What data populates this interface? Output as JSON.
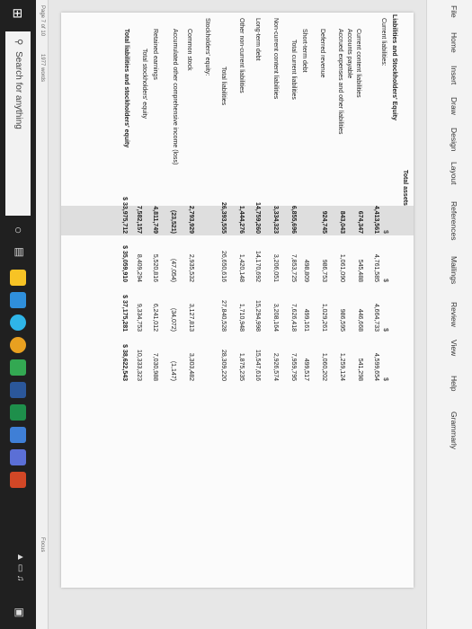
{
  "ribbon": {
    "tabs": [
      "File",
      "Home",
      "Insert",
      "Draw",
      "Design",
      "Layout",
      "References",
      "Mailings",
      "Review",
      "View",
      "Help",
      "Grammarly"
    ]
  },
  "document": {
    "total_assets_label": "Total assets",
    "section_title": "Liabilities and Stockholders' Equity",
    "current_liabilities_label": "Current liabilities:",
    "rows": [
      {
        "label": "",
        "values": [
          "$",
          "$",
          "$",
          "$"
        ],
        "bold": false
      },
      {
        "label": "",
        "values": [
          "4,413,561",
          "4,761,585",
          "4,664,733",
          "4,599,654"
        ],
        "bold": true
      },
      {
        "label": "Current content liabilities",
        "values": [
          "674,347",
          "545,488",
          "446,668",
          "541,298"
        ],
        "bold": false
      },
      {
        "label": "Accounts payable",
        "values": [
          "",
          "",
          "",
          ""
        ],
        "bold": false
      },
      {
        "label": "Accrued expenses and other liabilities",
        "values": [
          "843,043",
          "1,061,090",
          "986,595",
          "1,259,124"
        ],
        "bold": false
      },
      {
        "label": "Deferred revenue",
        "values": [
          "924,745",
          "986,753",
          "1,029,261",
          "1,060,202"
        ],
        "bold": false
      },
      {
        "label": "Short-term debt",
        "values": [
          "",
          "498,809",
          "499,161",
          "499,517"
        ],
        "bold": false
      },
      {
        "label": "Total current liabilities",
        "values": [
          "6,855,696",
          "7,853,725",
          "7,626,418",
          "7,959,795"
        ],
        "bold": true
      },
      {
        "label": "Non-current content liabilities",
        "values": [
          "3,334,323",
          "3,206,051",
          "3,208,164",
          "2,926,574"
        ],
        "bold": false
      },
      {
        "label": "Long-term debt",
        "values": [
          "14,759,260",
          "14,170,692",
          "15,294,998",
          "15,547,616"
        ],
        "bold": false
      },
      {
        "label": "Other non-current liabilities",
        "values": [
          "1,444,276",
          "1,420,148",
          "1,710,948",
          "1,875,235"
        ],
        "bold": false
      },
      {
        "label": "Total liabilities",
        "values": [
          "26,393,555",
          "26,650,616",
          "27,840,528",
          "28,309,220"
        ],
        "bold": true
      },
      {
        "label": "Stockholders' equity:",
        "values": [
          "",
          "",
          "",
          ""
        ],
        "bold": false
      },
      {
        "label": "Common stock",
        "values": [
          "2,793,929",
          "2,935,532",
          "3,127,813",
          "3,303,482"
        ],
        "bold": false
      },
      {
        "label": "Accumulated other comprehensive income (loss)",
        "values": [
          "(23,521)",
          "(47,054)",
          "(34,072)",
          "(1,147)"
        ],
        "bold": false
      },
      {
        "label": "Retained earnings",
        "values": [
          "4,811,749",
          "5,520,816",
          "6,241,012",
          "7,030,988"
        ],
        "bold": false
      },
      {
        "label": "Total stockholders' equity",
        "values": [
          "7,582,157",
          "8,409,294",
          "9,334,753",
          "10,333,323"
        ],
        "bold": true
      },
      {
        "label": "Total liabilities and stockholders' equity",
        "values": [
          "$ 33,975,712",
          "$ 35,059,910",
          "$ 37,175,281",
          "$ 38,622,543"
        ],
        "bold": true
      }
    ]
  },
  "status": {
    "page": "Page 7 of 10",
    "words": "1977 words",
    "focus": "Focus"
  },
  "taskbar": {
    "search_placeholder": "Search for anything"
  }
}
